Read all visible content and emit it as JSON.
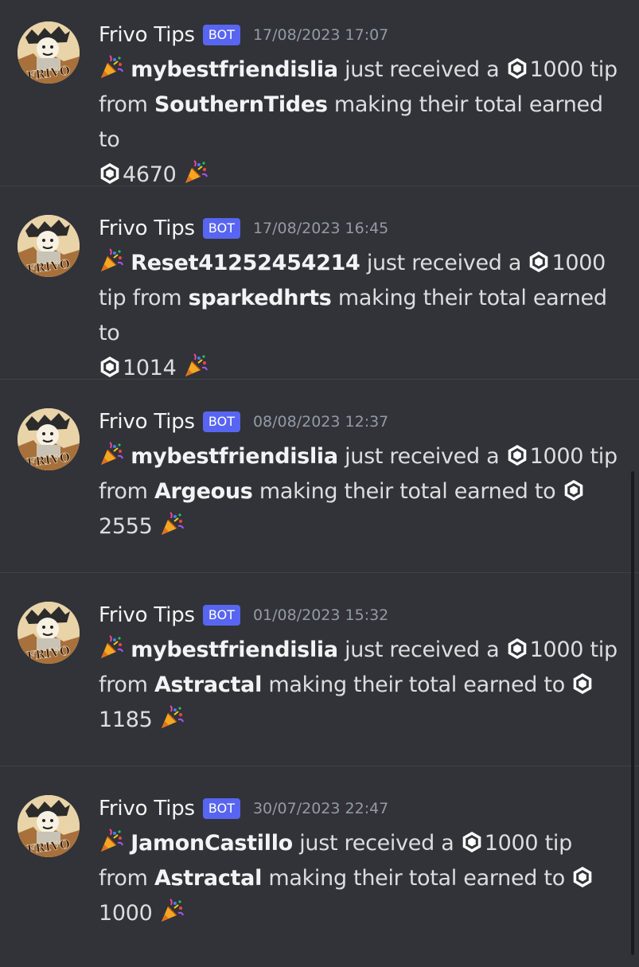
{
  "messages": [
    {
      "author": "Frivo Tips",
      "tag": "BOT",
      "timestamp": "17/08/2023 17:07",
      "recipient": "mybestfriendislia",
      "text_received": "just received a",
      "tip_amount": "1000",
      "text_tip_from": "tip",
      "text_from": "from",
      "sender": "SouthernTides",
      "text_total": "making their total earned to",
      "total": "4670"
    },
    {
      "author": "Frivo Tips",
      "tag": "BOT",
      "timestamp": "17/08/2023 16:45",
      "recipient": "Reset41252454214",
      "text_received": "just received a",
      "tip_amount": "1000",
      "text_tip_from": "tip",
      "text_from": "from",
      "sender": "sparkedhrts",
      "text_total": "making their total earned to",
      "total": "1014"
    },
    {
      "author": "Frivo Tips",
      "tag": "BOT",
      "timestamp": "08/08/2023 12:37",
      "recipient": "mybestfriendislia",
      "text_received": "just received a",
      "tip_amount": "1000",
      "text_tip_from": "tip",
      "text_from": "from",
      "sender": "Argeous",
      "text_total": "making their total earned to",
      "total": "2555"
    },
    {
      "author": "Frivo Tips",
      "tag": "BOT",
      "timestamp": "01/08/2023 15:32",
      "recipient": "mybestfriendislia",
      "text_received": "just received a",
      "tip_amount": "1000",
      "text_tip_from": "tip",
      "text_from": "from",
      "sender": "Astractal",
      "text_total": "making their total earned to",
      "total": "1185"
    },
    {
      "author": "Frivo Tips",
      "tag": "BOT",
      "timestamp": "30/07/2023 22:47",
      "recipient": "JamonCastillo",
      "text_received": "just received a",
      "tip_amount": "1000",
      "text_tip_from": "tip",
      "text_from": "from",
      "sender": "Astractal",
      "text_total": "making their total earned to",
      "total": "1000"
    }
  ],
  "avatar_text": "FRIVO",
  "icons": {
    "celebration": "party-popper-icon",
    "currency": "robux-icon"
  },
  "colors": {
    "background": "#313338",
    "bot_tag": "#5865f2",
    "timestamp": "#949ba4",
    "text": "#dbdee1"
  }
}
